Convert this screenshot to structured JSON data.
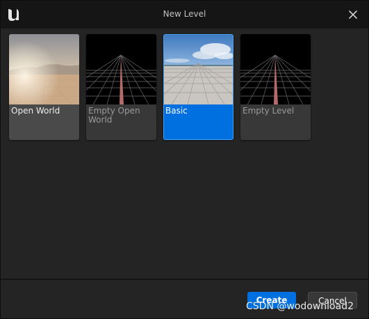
{
  "window": {
    "title": "New Level",
    "logo_icon": "unreal-engine-logo",
    "close_icon": "close-icon"
  },
  "templates": [
    {
      "label": "Open World",
      "state": "hover"
    },
    {
      "label": "Empty Open\nWorld",
      "state": "normal"
    },
    {
      "label": "Basic",
      "state": "selected"
    },
    {
      "label": "Empty Level",
      "state": "normal"
    }
  ],
  "footer": {
    "create_label": "Create",
    "cancel_label": "Cancel"
  },
  "watermark": "CSDN @wodownload2",
  "colors": {
    "accent": "#0070e0",
    "background": "#242424",
    "titlebar": "#151515"
  }
}
